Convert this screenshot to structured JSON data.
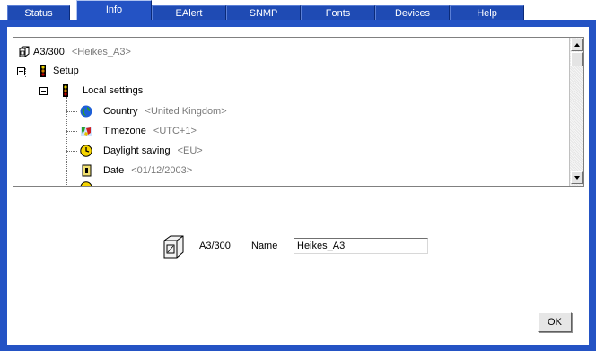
{
  "tabs": [
    {
      "label": "Status",
      "active": false
    },
    {
      "label": "Info",
      "active": true
    },
    {
      "label": "EAlert",
      "active": false
    },
    {
      "label": "SNMP",
      "active": false
    },
    {
      "label": "Fonts",
      "active": false
    },
    {
      "label": "Devices",
      "active": false
    },
    {
      "label": "Help",
      "active": false
    }
  ],
  "tree": {
    "root": {
      "label": "A3/300",
      "value": "<Heikes_A3>",
      "icon": "device-box-icon"
    },
    "setup": {
      "label": "Setup",
      "icon": "traffic-light-icon"
    },
    "local_settings": {
      "label": "Local settings",
      "icon": "traffic-light-icon"
    },
    "items": [
      {
        "label": "Country",
        "value": "<United Kingdom>",
        "icon": "globe-icon"
      },
      {
        "label": "Timezone",
        "value": "<UTC+1>",
        "icon": "timezone-map-icon"
      },
      {
        "label": "Daylight saving",
        "value": "<EU>",
        "icon": "clock-icon"
      },
      {
        "label": "Date",
        "value": "<01/12/2003>",
        "icon": "calendar-icon"
      }
    ]
  },
  "detail": {
    "device_name": "A3/300",
    "name_label": "Name",
    "name_value": "Heikes_A3"
  },
  "ok_label": "OK",
  "colors": {
    "accent": "#2453c4",
    "tab": "#1f4bb4",
    "muted_text": "#7a7a7a"
  }
}
